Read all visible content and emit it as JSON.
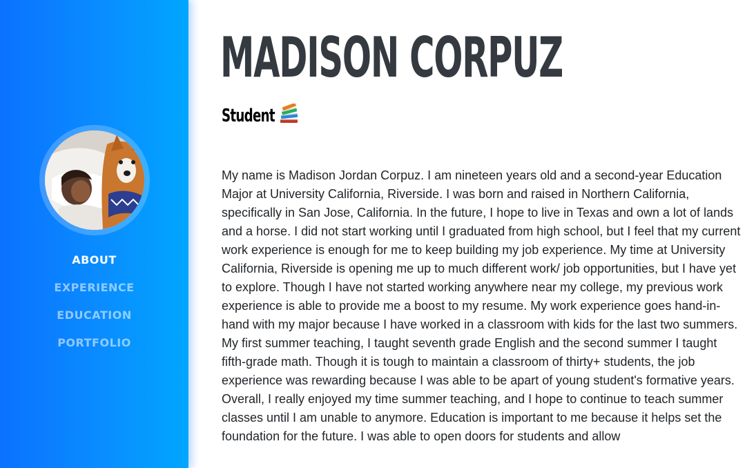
{
  "sidebar": {
    "avatar_alt": "Profile photo",
    "nav": [
      {
        "label": "ABOUT",
        "active": true
      },
      {
        "label": "EXPERIENCE",
        "active": false
      },
      {
        "label": "EDUCATION",
        "active": false
      },
      {
        "label": "PORTFOLIO",
        "active": false
      }
    ]
  },
  "about": {
    "name": "MADISON CORPUZ",
    "subtitle": "Student",
    "subtitle_icon": "books-emoji-icon",
    "bio": "My name is Madison Jordan Corpuz. I am nineteen years old and a second-year Education Major at University California, Riverside. I was born and raised in Northern California, specifically in San Jose, California. In the future, I hope to live in Texas and own a lot of lands and a horse. I did not start working until I graduated from high school, but I feel that my current work experience is enough for me to keep building my job experience. My time at University California, Riverside is opening me up to much different work/ job opportunities, but I have yet to explore. Though I have not started working anywhere near my college, my previous work experience is able to provide me a boost to my resume. My work experience goes hand-in-hand with my major because I have worked in a classroom with kids for the last two summers. My first summer teaching, I taught seventh grade English and the second summer I taught fifth-grade math. Though it is tough to maintain a classroom of thirty+ students, the job experience was rewarding because I was able to be apart of young student's formative years. Overall, I really enjoyed my time summer teaching, and I hope to continue to teach summer classes until I am unable to anymore. Education is important to me because it helps set the foundation for the future. I was able to open doors for students and allow"
  },
  "colors": {
    "sidebar_start": "#0a72ff",
    "sidebar_end": "#00a6ff",
    "heading": "#343a40",
    "body_text": "#212529",
    "nav_active": "#ffffff"
  }
}
